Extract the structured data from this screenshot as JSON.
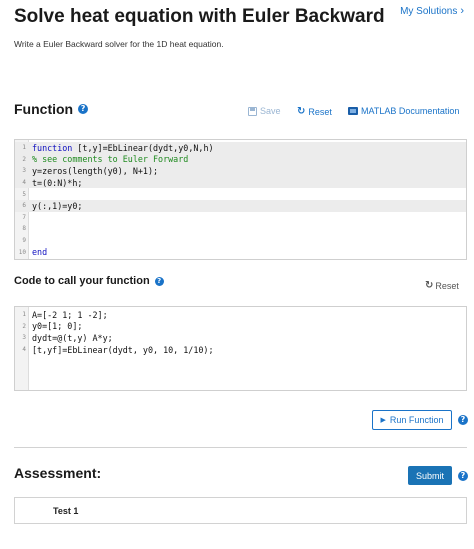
{
  "page": {
    "title": "Solve heat equation with Euler Backward",
    "my_solutions": "My Solutions",
    "description": "Write a Euler Backward solver for the 1D heat equation."
  },
  "function_section": {
    "title": "Function",
    "save_label": "Save",
    "reset_label": "Reset",
    "doc_label": "MATLAB Documentation",
    "code": [
      [
        {
          "t": "kw",
          "s": "function"
        },
        {
          "t": "",
          "s": " [t,y]=EbLinear(dydt,y0,N,h)"
        }
      ],
      [
        {
          "t": "cm",
          "s": "% see comments to Euler Forward"
        }
      ],
      [
        {
          "t": "",
          "s": "y=zeros(length(y0), N+1);"
        }
      ],
      [
        {
          "t": "",
          "s": "t=(0:N)*h;"
        }
      ],
      [],
      [
        {
          "t": "",
          "s": "y(:,1)=y0;"
        }
      ],
      [],
      [],
      [],
      [
        {
          "t": "kw",
          "s": "end"
        }
      ]
    ],
    "shaded_lines": [
      1,
      2,
      3,
      4,
      6
    ]
  },
  "call_section": {
    "title": "Code to call your function",
    "reset_label": "Reset",
    "code": [
      [
        {
          "t": "",
          "s": "A=[-2 1; 1 -2];"
        }
      ],
      [
        {
          "t": "",
          "s": "y0=[1; 0];"
        }
      ],
      [
        {
          "t": "",
          "s": "dydt=@(t,y) A*y;"
        }
      ],
      [
        {
          "t": "",
          "s": "[t,yf]=EbLinear(dydt, y0, 10, 1/10);"
        }
      ]
    ],
    "run_label": "Run Function"
  },
  "assessment": {
    "title": "Assessment:",
    "submit_label": "Submit",
    "tests": [
      "Test 1"
    ]
  },
  "icons": {
    "help": "help-icon",
    "save": "save-icon",
    "reset": "reset-icon",
    "doc": "matlab-doc-icon",
    "run": "play-icon",
    "chevron": "chevron-right-icon"
  },
  "colors": {
    "accent": "#1a73c8",
    "submit_bg": "#1a73b5",
    "keyword": "#1010c0",
    "comment": "#1f8a1f"
  }
}
